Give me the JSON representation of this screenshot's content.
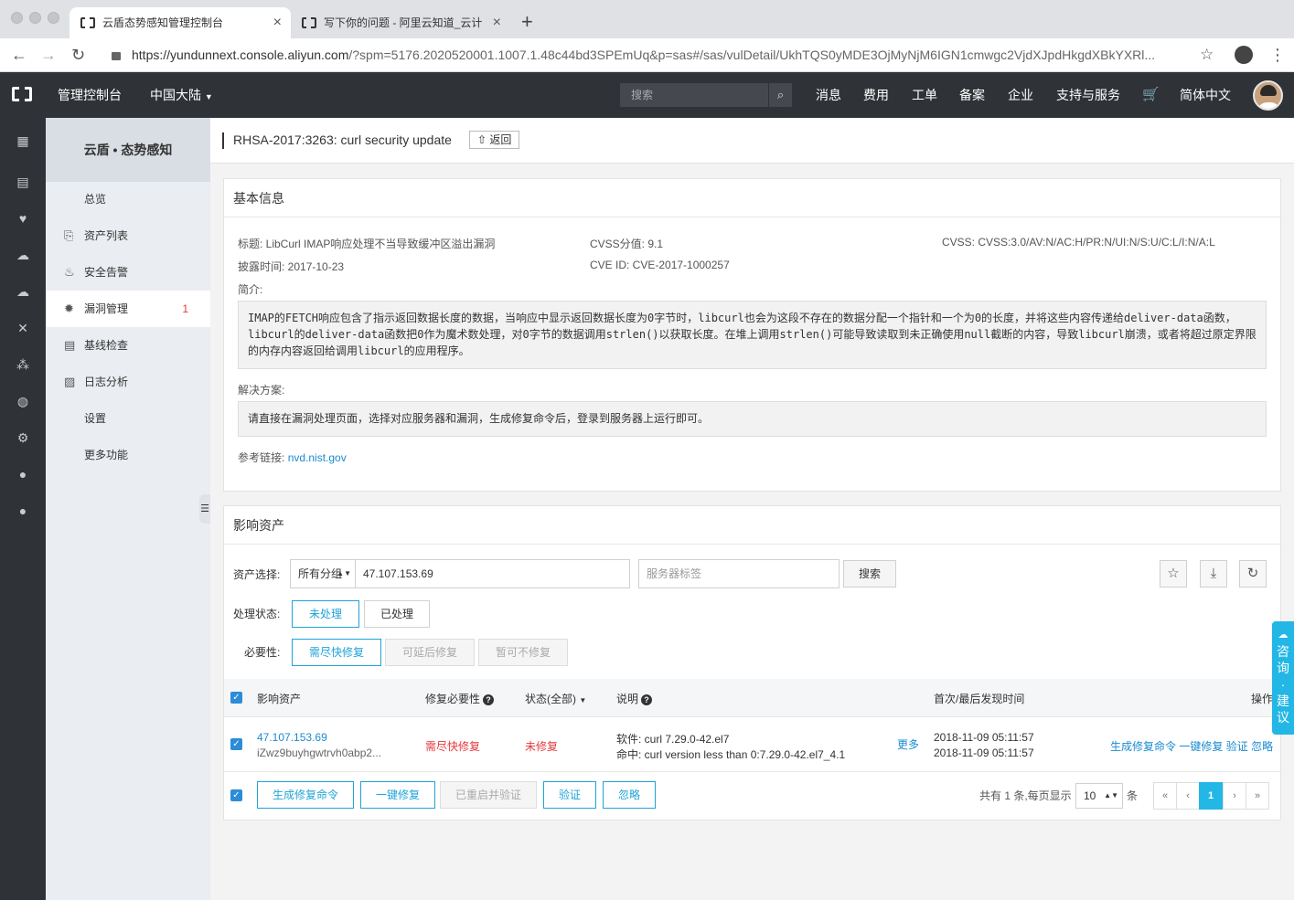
{
  "browser": {
    "tabs": [
      {
        "title": "云盾态势感知管理控制台",
        "close": "×"
      },
      {
        "title": "写下你的问题 - 阿里云知道_云计",
        "close": "×"
      }
    ],
    "new_tab": "+",
    "url_host": "https://yundunnext.console.aliyun.com",
    "url_rest": "/?spm=5176.2020520001.1007.1.48c44bd3SPEmUq&p=sas#/sas/vulDetail/UkhTQS0yMDE3OjMyNjM6IGN1cmwgc2VjdXJpdHkgdXBkYXRl..."
  },
  "topnav": {
    "console": "管理控制台",
    "region": "中国大陆",
    "search_placeholder": "搜索",
    "items": [
      "消息",
      "费用",
      "工单",
      "备案",
      "企业",
      "支持与服务"
    ],
    "language": "简体中文"
  },
  "sidebar": {
    "title": "云盾 • 态势感知",
    "items": [
      {
        "label": "总览"
      },
      {
        "label": "资产列表"
      },
      {
        "label": "安全告警"
      },
      {
        "label": "漏洞管理",
        "count": "1"
      },
      {
        "label": "基线检查"
      },
      {
        "label": "日志分析"
      },
      {
        "label": "设置"
      },
      {
        "label": "更多功能"
      }
    ]
  },
  "header": {
    "title": "RHSA-2017:3263: curl security update",
    "back": "返回"
  },
  "basic": {
    "heading": "基本信息",
    "title_line": "标题: LibCurl IMAP响应处理不当导致缓冲区溢出漏洞",
    "cvss_score": "CVSS分值: 9.1",
    "cvss_vector": "CVSS: CVSS:3.0/AV:N/AC:H/PR:N/UI:N/S:U/C:L/I:N/A:L",
    "disclosed": "披露时间: 2017-10-23",
    "cve": "CVE ID: CVE-2017-1000257",
    "summary_label": "简介:",
    "summary": "IMAP的FETCH响应包含了指示返回数据长度的数据，当响应中显示返回数据长度为0字节时，libcurl也会为这段不存在的数据分配一个指针和一个为0的长度，并将这些内容传递给deliver-data函数，libcurl的deliver-data函数把0作为魔术数处理，对0字节的数据调用strlen()以获取长度。在堆上调用strlen()可能导致读取到未正确使用null截断的内容，导致libcurl崩溃，或者将超过原定界限的内存内容返回给调用libcurl的应用程序。",
    "solution_label": "解决方案:",
    "solution": "请直接在漏洞处理页面，选择对应服务器和漏洞，生成修复命令后，登录到服务器上运行即可。",
    "ref_label": "参考链接:",
    "ref_link": "nvd.nist.gov"
  },
  "assets": {
    "heading": "影响资产",
    "asset_label": "资产选择:",
    "group_select": "所有分组",
    "asset_value": "47.107.153.69",
    "tag_placeholder": "服务器标签",
    "search_btn": "搜索",
    "status_label": "处理状态:",
    "status_opts": [
      "未处理",
      "已处理"
    ],
    "need_label": "必要性:",
    "need_opts": [
      "需尽快修复",
      "可延后修复",
      "暂可不修复"
    ],
    "columns": {
      "asset": "影响资产",
      "necessity": "修复必要性",
      "status": "状态(全部)",
      "desc": "说明",
      "time": "首次/最后发现时间",
      "ops": "操作"
    },
    "row": {
      "ip": "47.107.153.69",
      "id": "iZwz9buyhgwtrvh0abp2...",
      "necessity": "需尽快修复",
      "status": "未修复",
      "software": "软件: curl 7.29.0-42.el7",
      "hit": "命中: curl version less than 0:7.29.0-42.el7_4.1",
      "more": "更多",
      "first": "2018-11-09 05:11:57",
      "last": "2018-11-09 05:11:57",
      "ops": [
        "生成修复命令",
        "一键修复",
        "验证",
        "忽略"
      ]
    },
    "bulk": [
      "生成修复命令",
      "一键修复",
      "已重启并验证",
      "验证",
      "忽略"
    ],
    "total": "共有 1 条,每页显示",
    "page_size": "10",
    "unit": "条",
    "pages": [
      "«",
      "‹",
      "1",
      "›",
      "»"
    ]
  },
  "consult": [
    "咨",
    "询",
    "·",
    "建",
    "议"
  ]
}
